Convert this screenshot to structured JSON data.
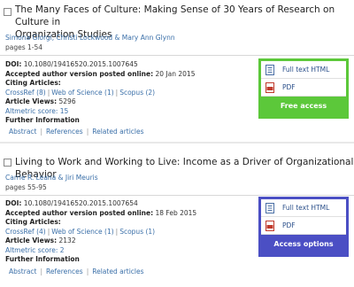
{
  "articles": [
    {
      "title_line1": "The Many Faces of Culture: Making Sense of 30 Years of Research on Culture in",
      "title_line2": "Organization Studies",
      "authors": "Simona Giorgi, Christi Lockwood & Mary Ann Glynn",
      "pages": "pages 1-54",
      "doi_label": "DOI:",
      "doi": "10.1080/19416520.2015.1007645",
      "accepted_label": "Accepted author version posted online:",
      "accepted_date": "20 Jan 2015",
      "citing_label": "Citing Articles:",
      "citing": [
        "CrossRef (8)",
        "Web of Science (1)",
        "Scopus (2)"
      ],
      "views_label": "Article Views:",
      "views": "5296",
      "altmetric": "Altmetric score: 15",
      "further": "Further Information",
      "tabs": [
        "Abstract",
        "References",
        "Related articles"
      ],
      "access": {
        "fulltext": "Full text HTML",
        "pdf": "PDF",
        "button": "Free access",
        "color": "#5cc83a"
      }
    },
    {
      "title_line1": "Living to Work and Working to Live: Income as a Driver of Organizational Behavior",
      "authors": "Carrie R. Leana & Jiri Meuris",
      "pages": "pages 55-95",
      "doi_label": "DOI:",
      "doi": "10.1080/19416520.2015.1007654",
      "accepted_label": "Accepted author version posted online:",
      "accepted_date": "18 Feb 2015",
      "citing_label": "Citing Articles:",
      "citing": [
        "CrossRef (4)",
        "Web of Science (1)",
        "Scopus (1)"
      ],
      "views_label": "Article Views:",
      "views": "2132",
      "altmetric": "Altmetric score: 2",
      "further": "Further Information",
      "tabs": [
        "Abstract",
        "References",
        "Related articles"
      ],
      "access": {
        "fulltext": "Full text HTML",
        "pdf": "PDF",
        "button": "Access options",
        "color": "#4b4fc4"
      }
    }
  ]
}
